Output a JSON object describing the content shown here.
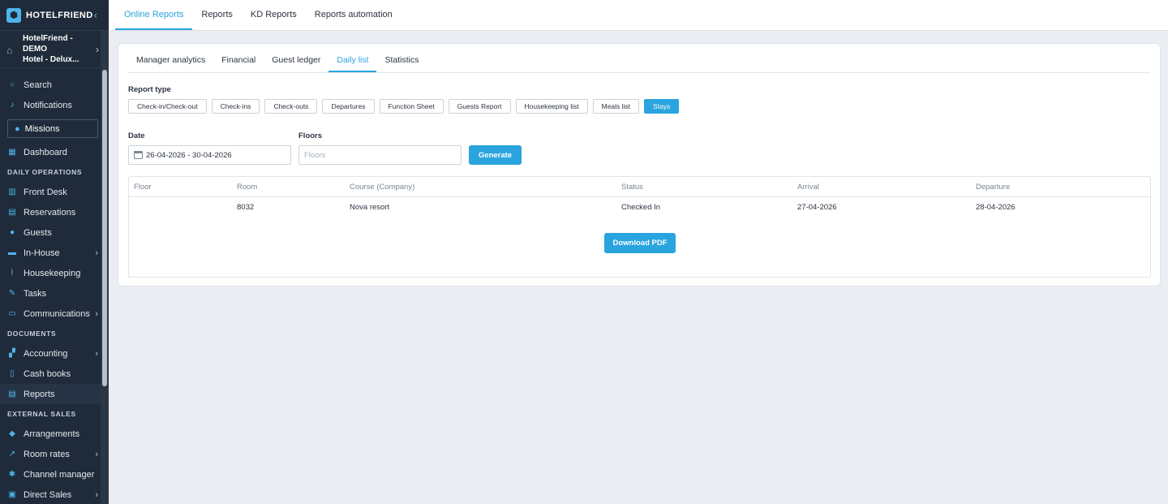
{
  "app": {
    "brand": "HOTELFRIEND",
    "brand_mark": "⬢"
  },
  "hotel": {
    "line1": "HotelFriend - DEMO",
    "line2": "Hotel - Delux..."
  },
  "sidebar": {
    "top_items": [
      {
        "label": "Search",
        "icon": "search-icon"
      },
      {
        "label": "Notifications",
        "icon": "bell-icon"
      }
    ],
    "missions": {
      "label": "Missions",
      "icon": "user-icon"
    },
    "dashboard": {
      "label": "Dashboard",
      "icon": "grid-icon"
    },
    "sections": {
      "daily_operations": "DAILY OPERATIONS",
      "documents": "DOCUMENTS",
      "external_sales": "EXTERNAL SALES"
    },
    "daily_items": [
      {
        "label": "Front Desk",
        "icon": "chart-icon",
        "chevron": false
      },
      {
        "label": "Reservations",
        "icon": "clipboard-icon",
        "chevron": false
      },
      {
        "label": "Guests",
        "icon": "person-icon",
        "chevron": false
      },
      {
        "label": "In-House",
        "icon": "bed-icon",
        "chevron": true
      },
      {
        "label": "Housekeeping",
        "icon": "broom-icon",
        "chevron": false
      },
      {
        "label": "Tasks",
        "icon": "wrench-icon",
        "chevron": false
      },
      {
        "label": "Communications",
        "icon": "chat-icon",
        "chevron": true
      }
    ],
    "document_items": [
      {
        "label": "Accounting",
        "icon": "blocks-icon",
        "chevron": true
      },
      {
        "label": "Cash books",
        "icon": "book-icon",
        "chevron": false
      },
      {
        "label": "Reports",
        "icon": "report-icon",
        "chevron": false,
        "active": true
      }
    ],
    "external_items": [
      {
        "label": "Arrangements",
        "icon": "tag-icon",
        "chevron": false
      },
      {
        "label": "Room rates",
        "icon": "trend-icon",
        "chevron": true
      },
      {
        "label": "Channel manager",
        "icon": "network-icon",
        "chevron": false
      },
      {
        "label": "Direct Sales",
        "icon": "store-icon",
        "chevron": true
      }
    ]
  },
  "top_tabs": [
    {
      "label": "Online Reports",
      "active": true
    },
    {
      "label": "Reports",
      "active": false
    },
    {
      "label": "KD Reports",
      "active": false
    },
    {
      "label": "Reports automation",
      "active": false
    }
  ],
  "sub_tabs": [
    {
      "label": "Manager analytics",
      "active": false
    },
    {
      "label": "Financial",
      "active": false
    },
    {
      "label": "Guest ledger",
      "active": false
    },
    {
      "label": "Daily list",
      "active": true
    },
    {
      "label": "Statistics",
      "active": false
    }
  ],
  "report_type": {
    "label": "Report type",
    "options": [
      {
        "label": "Check-in/Check-out",
        "active": false
      },
      {
        "label": "Check-ins",
        "active": false
      },
      {
        "label": "Check-outs",
        "active": false
      },
      {
        "label": "Departures",
        "active": false
      },
      {
        "label": "Function Sheet",
        "active": false
      },
      {
        "label": "Guests Report",
        "active": false
      },
      {
        "label": "Housekeeping list",
        "active": false
      },
      {
        "label": "Meals list",
        "active": false
      },
      {
        "label": "Stays",
        "active": true
      }
    ]
  },
  "filters": {
    "date_label": "Date",
    "date_value": "26-04-2026 - 30-04-2026",
    "floors_label": "Floors",
    "floors_placeholder": "Floors",
    "generate_label": "Generate"
  },
  "table": {
    "columns": [
      "Floor",
      "Room",
      "Course (Company)",
      "Status",
      "Arrival",
      "Departure"
    ],
    "rows": [
      [
        "",
        "8032",
        "Nova resort",
        "Checked In",
        "27-04-2026",
        "28-04-2026"
      ]
    ],
    "download_label": "Download PDF"
  },
  "colors": {
    "accent": "#2aa4de",
    "sidebar_bg": "#1f2b3a",
    "page_bg": "#eaedf1"
  }
}
